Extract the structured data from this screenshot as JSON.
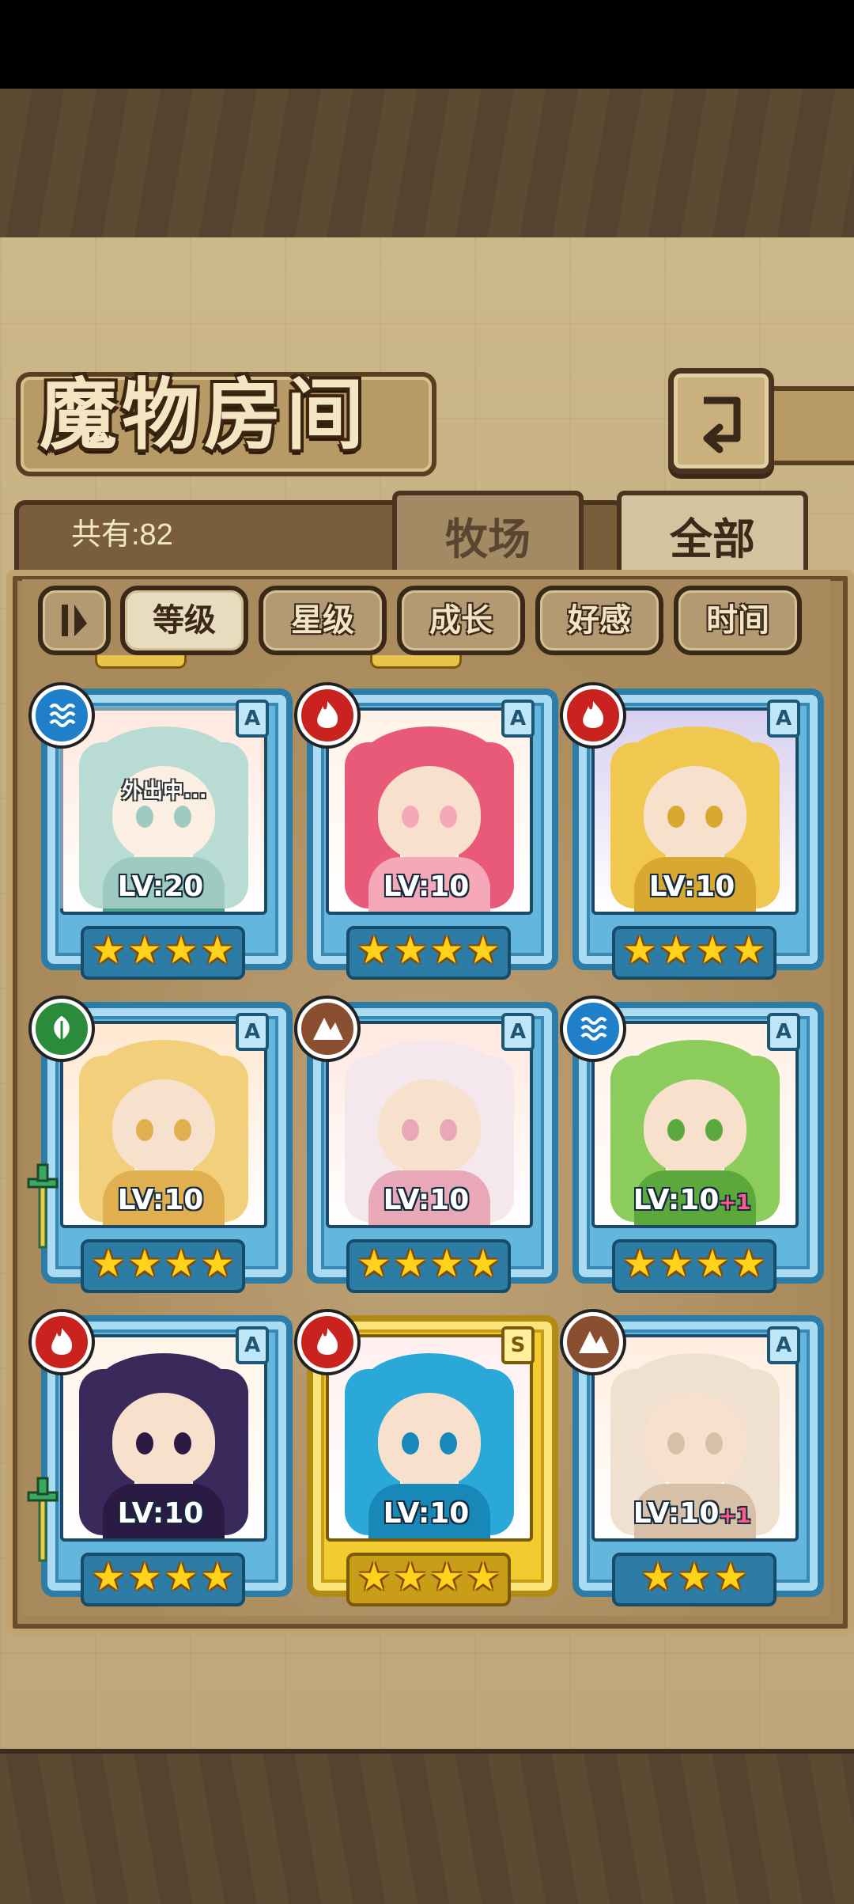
{
  "header": {
    "title": "魔物房间"
  },
  "summary": {
    "count_label": "共有:82"
  },
  "tabs": [
    {
      "label": "牧场",
      "active": false
    },
    {
      "label": "全部",
      "active": true
    }
  ],
  "filters": [
    {
      "label": "等级",
      "active": true
    },
    {
      "label": "星级",
      "active": false
    },
    {
      "label": "成长",
      "active": false
    },
    {
      "label": "好感",
      "active": false
    },
    {
      "label": "时间",
      "active": false
    }
  ],
  "cards": [
    {
      "level": "LV:20",
      "bonus": "",
      "rank": "A",
      "element": "water",
      "stars": 4,
      "status": "外出中...",
      "frame": "blue"
    },
    {
      "level": "LV:10",
      "bonus": "",
      "rank": "A",
      "element": "fire",
      "stars": 4,
      "status": "",
      "frame": "blue"
    },
    {
      "level": "LV:10",
      "bonus": "",
      "rank": "A",
      "element": "fire",
      "stars": 4,
      "status": "",
      "frame": "blue"
    },
    {
      "level": "LV:10",
      "bonus": "",
      "rank": "A",
      "element": "wind",
      "stars": 4,
      "status": "",
      "frame": "blue"
    },
    {
      "level": "LV:10",
      "bonus": "",
      "rank": "A",
      "element": "earth",
      "stars": 4,
      "status": "",
      "frame": "blue"
    },
    {
      "level": "LV:10",
      "bonus": "+1",
      "rank": "A",
      "element": "water",
      "stars": 4,
      "status": "",
      "frame": "blue"
    },
    {
      "level": "LV:10",
      "bonus": "",
      "rank": "A",
      "element": "fire",
      "stars": 4,
      "status": "",
      "frame": "blue"
    },
    {
      "level": "LV:10",
      "bonus": "",
      "rank": "S",
      "element": "fire",
      "stars": 4,
      "status": "",
      "frame": "gold"
    },
    {
      "level": "LV:10",
      "bonus": "+1",
      "rank": "A",
      "element": "earth",
      "stars": 3,
      "status": "",
      "frame": "blue"
    }
  ],
  "colors": {
    "fire": "#c9221f",
    "water": "#1f7fc9",
    "wind": "#2a8c3a",
    "earth": "#8a4e30",
    "frame_blue": "#63b6de",
    "frame_gold": "#f2cc2e",
    "star": "#ffd21c"
  }
}
